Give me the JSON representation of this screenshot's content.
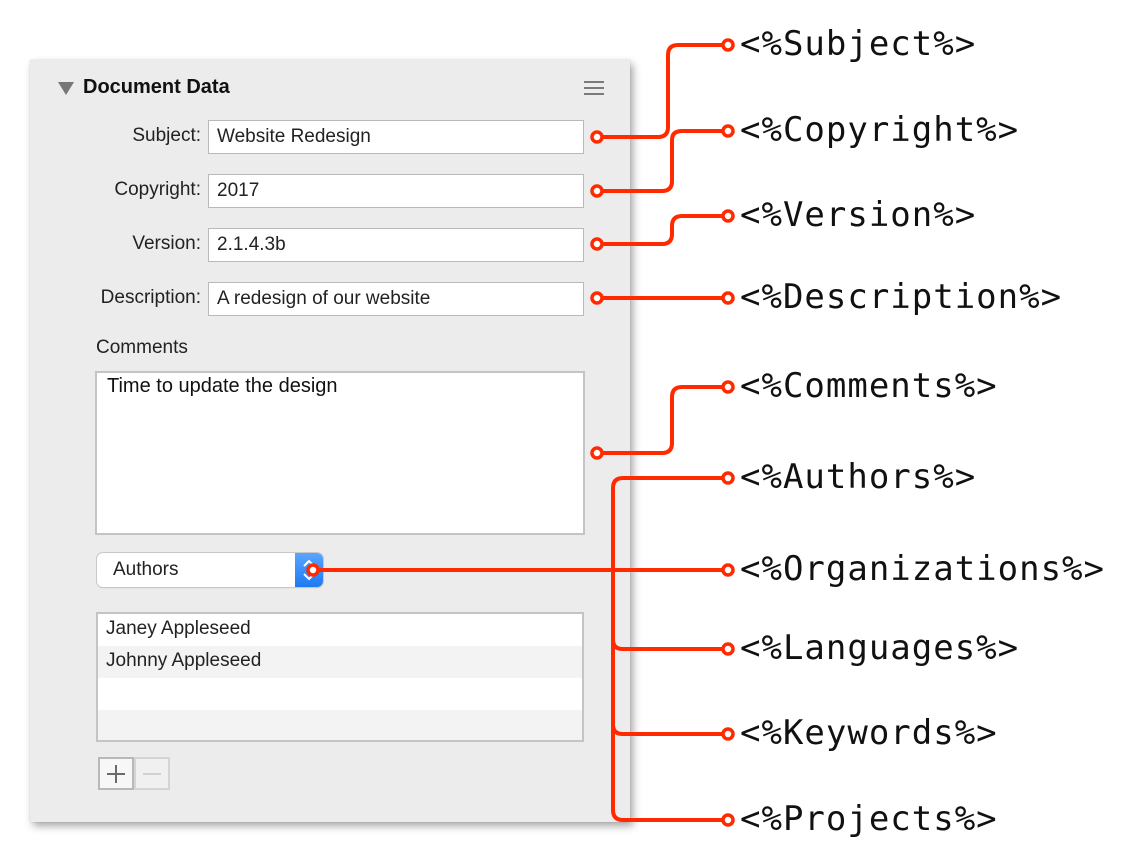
{
  "panel": {
    "title": "Document Data",
    "fields": [
      {
        "label": "Subject:",
        "value": "Website Redesign"
      },
      {
        "label": "Copyright:",
        "value": "2017"
      },
      {
        "label": "Version:",
        "value": "2.1.4.3b"
      },
      {
        "label": "Description:",
        "value": "A redesign of our website"
      }
    ],
    "comments": {
      "label": "Comments",
      "value": "Time to update the design"
    },
    "popup": {
      "selected": "Authors"
    },
    "list": {
      "items": [
        "Janey Appleseed",
        "Johnny Appleseed",
        "",
        ""
      ]
    },
    "buttons": {
      "add": "+",
      "remove": "−"
    }
  },
  "tags": [
    "<%Subject%>",
    "<%Copyright%>",
    "<%Version%>",
    "<%Description%>",
    "<%Comments%>",
    "<%Authors%>",
    "<%Organizations%>",
    "<%Languages%>",
    "<%Keywords%>",
    "<%Projects%>"
  ],
  "colors": {
    "connector": "#ff2a00",
    "accent": "#1d7af3"
  }
}
